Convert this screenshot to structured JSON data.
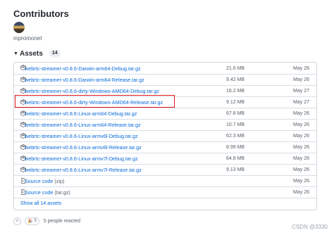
{
  "contributors": {
    "heading": "Contributors",
    "users": [
      "mpromonet"
    ]
  },
  "assets": {
    "title": "Assets",
    "count": "14",
    "items": [
      {
        "name": "webrtc-streamer-v0.8.6-Darwin-arm64-Debug.tar.gz",
        "size": "21.6 MB",
        "date": "May 26"
      },
      {
        "name": "webrtc-streamer-v0.8.6-Darwin-arm64-Release.tar.gz",
        "size": "9.42 MB",
        "date": "May 26"
      },
      {
        "name": "webrtc-streamer-v0.8.6-dirty-Windows-AMD64-Debug.tar.gz",
        "size": "16.2 MB",
        "date": "May 27"
      },
      {
        "name": "webrtc-streamer-v0.8.6-dirty-Windows-AMD64-Release.tar.gz",
        "size": "9.12 MB",
        "date": "May 27"
      },
      {
        "name": "webrtc-streamer-v0.8.6-Linux-arm64-Debug.tar.gz",
        "size": "67.8 MB",
        "date": "May 26"
      },
      {
        "name": "webrtc-streamer-v0.8.6-Linux-arm64-Release.tar.gz",
        "size": "10.7 MB",
        "date": "May 26"
      },
      {
        "name": "webrtc-streamer-v0.8.6-Linux-armv6l-Debug.tar.gz",
        "size": "62.3 MB",
        "date": "May 26"
      },
      {
        "name": "webrtc-streamer-v0.8.6-Linux-armv6l-Release.tar.gz",
        "size": "8.99 MB",
        "date": "May 26"
      },
      {
        "name": "webrtc-streamer-v0.8.6-Linux-armv7l-Debug.tar.gz",
        "size": "64.8 MB",
        "date": "May 26"
      },
      {
        "name": "webrtc-streamer-v0.8.6-Linux-armv7l-Release.tar.gz",
        "size": "9.13 MB",
        "date": "May 26"
      }
    ],
    "sources": [
      {
        "name": "Source code",
        "format": "(zip)",
        "date": "May 26"
      },
      {
        "name": "Source code",
        "format": "(tar.gz)",
        "date": "May 26"
      }
    ],
    "show_all": "Show all 14 assets"
  },
  "reactions": {
    "count": "5",
    "text": "5 people reacted"
  },
  "watermark": "CSDN @3330",
  "colors": {
    "link": "#0969da",
    "muted": "#57606a",
    "highlight_border": "#e0161b"
  },
  "icons": {
    "asset": "package-icon",
    "source": "file-zip-icon",
    "smiley": "smiley-icon",
    "reaction": "hooray-icon"
  }
}
